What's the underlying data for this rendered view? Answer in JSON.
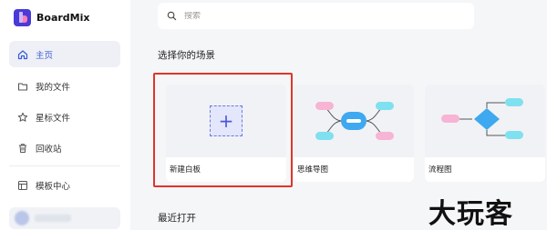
{
  "app": {
    "name": "BoardMix"
  },
  "sidebar": {
    "items": [
      {
        "label": "主页",
        "icon": "home-icon",
        "active": true
      },
      {
        "label": "我的文件",
        "icon": "folder-icon",
        "active": false
      },
      {
        "label": "星标文件",
        "icon": "star-icon",
        "active": false
      },
      {
        "label": "回收站",
        "icon": "trash-icon",
        "active": false
      },
      {
        "label": "模板中心",
        "icon": "template-icon",
        "active": false
      }
    ]
  },
  "search": {
    "placeholder": "搜索"
  },
  "scenes": {
    "title": "选择你的场景",
    "cards": [
      {
        "label": "新建白板",
        "icon": "plus-icon"
      },
      {
        "label": "思维导图",
        "icon": "mindmap-icon"
      },
      {
        "label": "流程图",
        "icon": "flowchart-icon"
      }
    ]
  },
  "recent": {
    "title": "最近打开"
  },
  "watermark": {
    "text": "大玩客"
  },
  "colors": {
    "accent": "#3a5bd9",
    "highlight": "#e0342a",
    "brand": "#4a3ad8"
  }
}
